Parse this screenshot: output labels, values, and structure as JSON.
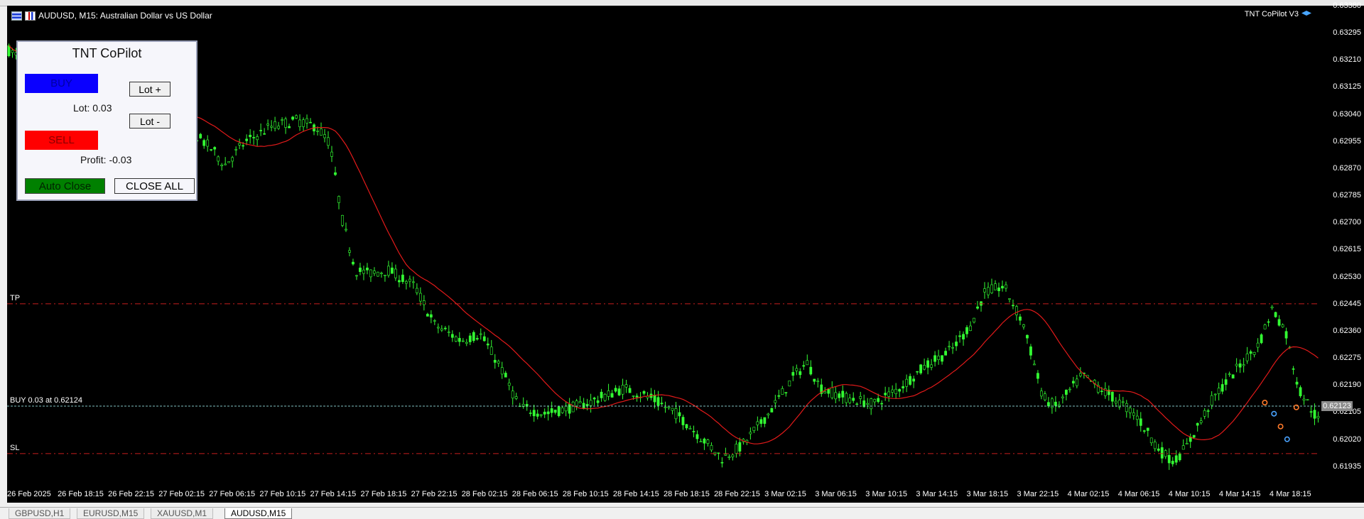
{
  "chart": {
    "title": "AUDUSD, M15:  Australian Dollar vs US Dollar",
    "indicator": "TNT CoPilot V3",
    "colors": {
      "bg": "#000000",
      "bull": "#33ff33",
      "ma": "#e21a1a",
      "level": "#c81e1e",
      "buyline": "#7fbfbf"
    }
  },
  "price_axis": {
    "ticks": [
      "0.63380",
      "0.63295",
      "0.63210",
      "0.63125",
      "0.63040",
      "0.62955",
      "0.62870",
      "0.62785",
      "0.62700",
      "0.62615",
      "0.62530",
      "0.62445",
      "0.62360",
      "0.62275",
      "0.62190",
      "0.62105",
      "0.62020",
      "0.61935"
    ],
    "min": 0.6187,
    "max": 0.6338,
    "current_price": "0.62123"
  },
  "time_axis": {
    "ticks": [
      "26 Feb 2025",
      "26 Feb 18:15",
      "26 Feb 22:15",
      "27 Feb 02:15",
      "27 Feb 06:15",
      "27 Feb 10:15",
      "27 Feb 14:15",
      "27 Feb 18:15",
      "27 Feb 22:15",
      "28 Feb 02:15",
      "28 Feb 06:15",
      "28 Feb 10:15",
      "28 Feb 14:15",
      "28 Feb 18:15",
      "28 Feb 22:15",
      "3 Mar 02:15",
      "3 Mar 06:15",
      "3 Mar 10:15",
      "3 Mar 14:15",
      "3 Mar 18:15",
      "3 Mar 22:15",
      "4 Mar 02:15",
      "4 Mar 06:15",
      "4 Mar 10:15",
      "4 Mar 14:15",
      "4 Mar 18:15"
    ]
  },
  "levels": {
    "tp": {
      "label": "TP",
      "price": 0.62445
    },
    "buy": {
      "label": "BUY 0.03 at 0.62124",
      "price": 0.62124
    },
    "sl": {
      "label": "SL",
      "price": 0.61975
    }
  },
  "panel": {
    "title": "TNT CoPilot",
    "buy_label": "BUY",
    "sell_label": "SELL",
    "lot_plus": "Lot +",
    "lot_minus": "Lot -",
    "lot_text": "Lot: 0.03",
    "profit_text": "Profit: -0.03",
    "auto_close": "Auto Close",
    "close_all": "CLOSE ALL"
  },
  "tabs": [
    "GBPUSD,H1",
    "EURUSD,M15",
    "XAUUSD,M1",
    "AUDUSD,M15"
  ],
  "chart_data": {
    "type": "candlestick",
    "symbol": "AUDUSD",
    "timeframe": "M15",
    "path": [
      [
        0,
        0.6324
      ],
      [
        0.02,
        0.6318
      ],
      [
        0.05,
        0.6313
      ],
      [
        0.08,
        0.631
      ],
      [
        0.1,
        0.6306
      ],
      [
        0.13,
        0.6302
      ],
      [
        0.155,
        0.6293
      ],
      [
        0.165,
        0.6288
      ],
      [
        0.18,
        0.6295
      ],
      [
        0.2,
        0.63
      ],
      [
        0.22,
        0.6302
      ],
      [
        0.235,
        0.63
      ],
      [
        0.245,
        0.6295
      ],
      [
        0.255,
        0.627
      ],
      [
        0.265,
        0.6255
      ],
      [
        0.275,
        0.6254
      ],
      [
        0.29,
        0.6255
      ],
      [
        0.31,
        0.625
      ],
      [
        0.325,
        0.6238
      ],
      [
        0.345,
        0.6233
      ],
      [
        0.36,
        0.6235
      ],
      [
        0.375,
        0.6225
      ],
      [
        0.39,
        0.6212
      ],
      [
        0.41,
        0.621
      ],
      [
        0.44,
        0.6213
      ],
      [
        0.47,
        0.6218
      ],
      [
        0.49,
        0.6215
      ],
      [
        0.51,
        0.621
      ],
      [
        0.53,
        0.6202
      ],
      [
        0.545,
        0.6196
      ],
      [
        0.56,
        0.62
      ],
      [
        0.58,
        0.621
      ],
      [
        0.6,
        0.6222
      ],
      [
        0.61,
        0.6226
      ],
      [
        0.62,
        0.6218
      ],
      [
        0.64,
        0.6215
      ],
      [
        0.66,
        0.6213
      ],
      [
        0.68,
        0.6218
      ],
      [
        0.7,
        0.6225
      ],
      [
        0.72,
        0.623
      ],
      [
        0.735,
        0.6238
      ],
      [
        0.745,
        0.6248
      ],
      [
        0.76,
        0.625
      ],
      [
        0.775,
        0.6238
      ],
      [
        0.79,
        0.6215
      ],
      [
        0.8,
        0.6212
      ],
      [
        0.82,
        0.6222
      ],
      [
        0.84,
        0.6216
      ],
      [
        0.86,
        0.621
      ],
      [
        0.88,
        0.6198
      ],
      [
        0.89,
        0.6195
      ],
      [
        0.9,
        0.62
      ],
      [
        0.92,
        0.6215
      ],
      [
        0.94,
        0.6225
      ],
      [
        0.955,
        0.6232
      ],
      [
        0.965,
        0.6243
      ],
      [
        0.975,
        0.6236
      ],
      [
        0.985,
        0.6218
      ],
      [
        1.0,
        0.6208
      ]
    ]
  }
}
